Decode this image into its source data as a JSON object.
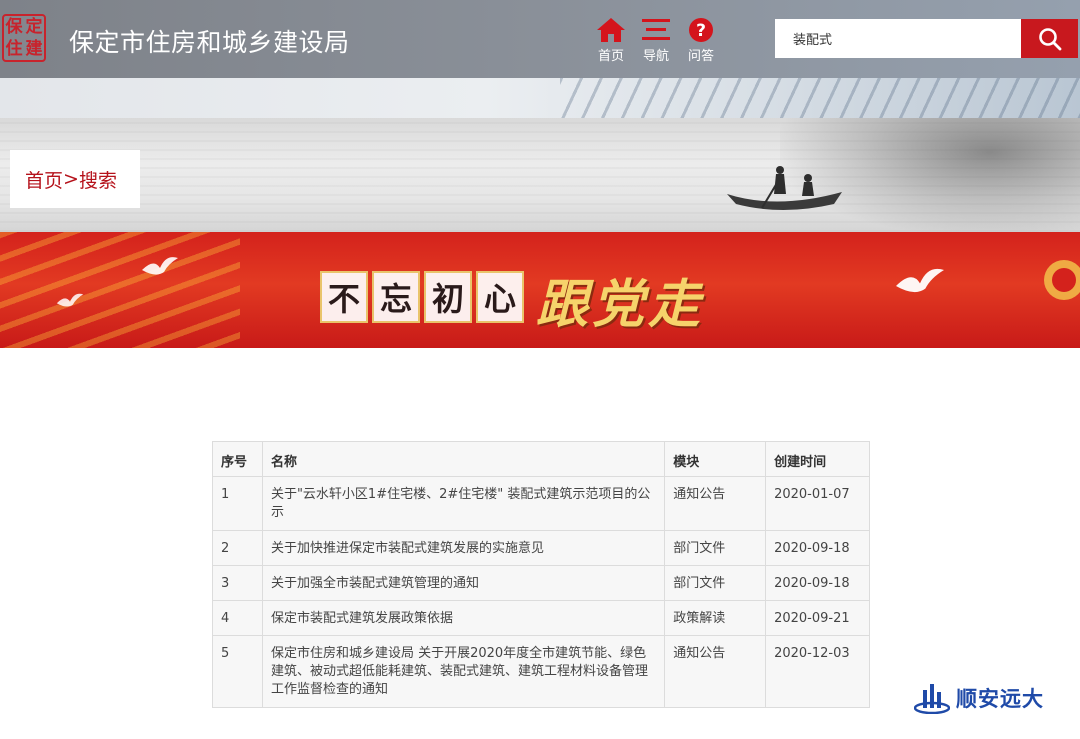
{
  "header": {
    "logo_chars": [
      "保",
      "定",
      "住",
      "建"
    ],
    "site_title": "保定市住房和城乡建设局",
    "nav": [
      {
        "label": "首页",
        "icon": "home-icon"
      },
      {
        "label": "导航",
        "icon": "menu-icon"
      },
      {
        "label": "问答",
        "icon": "question-icon"
      }
    ],
    "search": {
      "value": "装配式",
      "button_icon": "search-icon"
    }
  },
  "breadcrumb": {
    "home": "首页",
    "separator": ">",
    "current": "搜索"
  },
  "banner": {
    "boxed_chars": [
      "不",
      "忘",
      "初",
      "心"
    ],
    "tail": "跟党走"
  },
  "table": {
    "headers": {
      "no": "序号",
      "name": "名称",
      "module": "模块",
      "date": "创建时间"
    },
    "rows": [
      {
        "no": "1",
        "name": "关于\"云水轩小区1#住宅楼、2#住宅楼\" 装配式建筑示范项目的公示",
        "module": "通知公告",
        "date": "2020-01-07"
      },
      {
        "no": "2",
        "name": "关于加快推进保定市装配式建筑发展的实施意见",
        "module": "部门文件",
        "date": "2020-09-18"
      },
      {
        "no": "3",
        "name": "关于加强全市装配式建筑管理的通知",
        "module": "部门文件",
        "date": "2020-09-18"
      },
      {
        "no": "4",
        "name": "保定市装配式建筑发展政策依据",
        "module": "政策解读",
        "date": "2020-09-21"
      },
      {
        "no": "5",
        "name": "保定市住房和城乡建设局 关于开展2020年度全市建筑节能、绿色建筑、被动式超低能耗建筑、装配式建筑、建筑工程材料设备管理工作监督检查的通知",
        "module": "通知公告",
        "date": "2020-12-03"
      }
    ]
  },
  "watermark": {
    "text": "顺安远大"
  },
  "colors": {
    "brand_red": "#c8181e",
    "breadcrumb_red": "#b5121b",
    "watermark_blue": "#1f4aa8"
  }
}
